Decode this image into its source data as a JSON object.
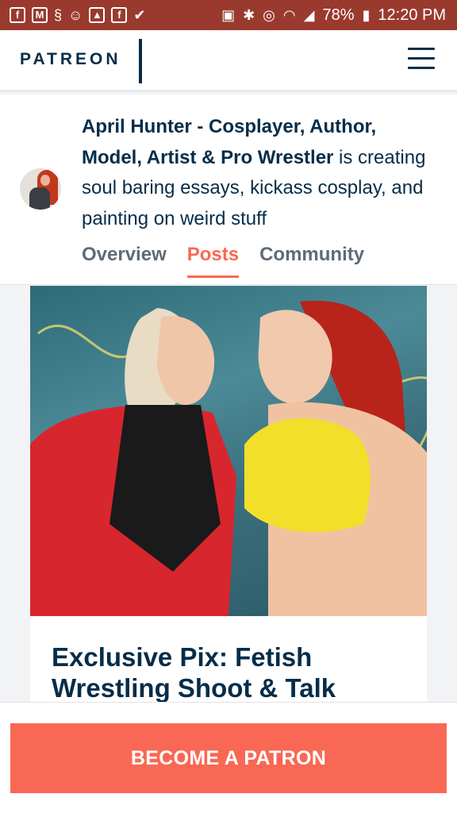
{
  "status_bar": {
    "left_icons": [
      "facebook-icon",
      "gmail-icon",
      "swirl-app-icon",
      "account-icon",
      "image-icon",
      "facebook-icon",
      "check-app-icon"
    ],
    "battery": "78%",
    "time": "12:20 PM"
  },
  "header": {
    "logo": "PATREON",
    "menu_icon": "hamburger-menu-icon"
  },
  "creator": {
    "name": "April Hunter - Cosplayer, Author, Model, Artist & Pro Wrestler",
    "tagline": " is creating soul baring essays, kickass cosplay, and painting on weird stuff"
  },
  "tabs": [
    {
      "label": "Overview",
      "active": false
    },
    {
      "label": "Posts",
      "active": true
    },
    {
      "label": "Community",
      "active": false
    }
  ],
  "post": {
    "title": "Exclusive Pix: Fetish Wrestling Shoot & Talk"
  },
  "cta": {
    "label": "BECOME A PATRON"
  },
  "colors": {
    "brand_navy": "#052d49",
    "accent_coral": "#f96854",
    "status_bar": "#9a3a2e"
  }
}
